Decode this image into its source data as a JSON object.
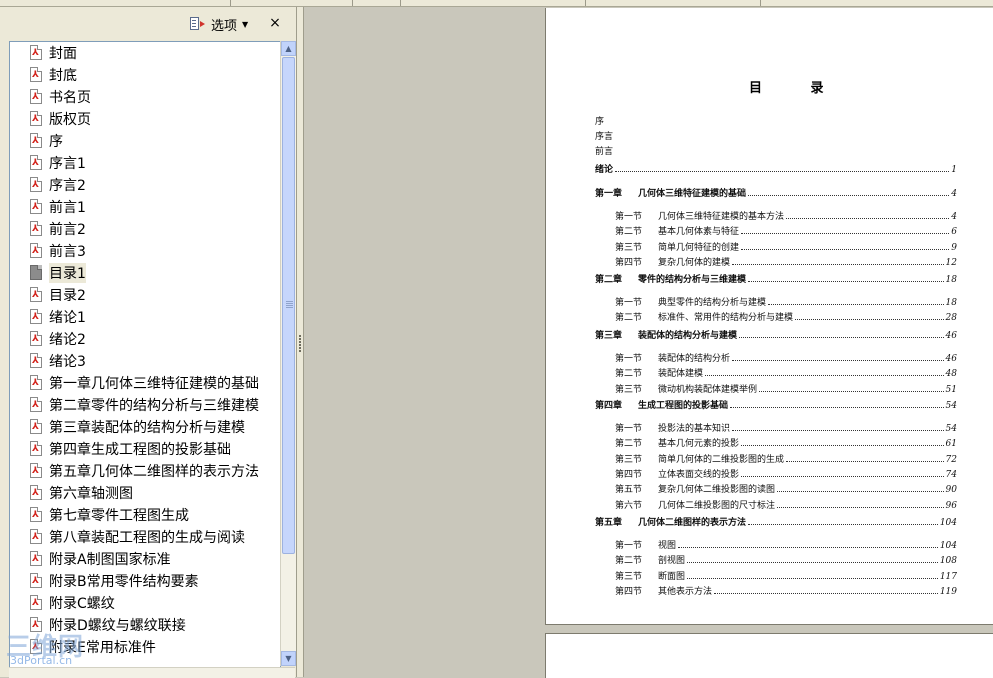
{
  "panel": {
    "options_label": "选项",
    "close_glyph": "×",
    "bookmarks": [
      {
        "label": "封面"
      },
      {
        "label": "封底"
      },
      {
        "label": "书名页"
      },
      {
        "label": "版权页"
      },
      {
        "label": "序"
      },
      {
        "label": "序言1"
      },
      {
        "label": "序言2"
      },
      {
        "label": "前言1"
      },
      {
        "label": "前言2"
      },
      {
        "label": "前言3"
      },
      {
        "label": "目录1",
        "current": true
      },
      {
        "label": "目录2"
      },
      {
        "label": "绪论1"
      },
      {
        "label": "绪论2"
      },
      {
        "label": "绪论3"
      },
      {
        "label": "第一章几何体三维特征建模的基础"
      },
      {
        "label": "第二章零件的结构分析与三维建模"
      },
      {
        "label": "第三章装配体的结构分析与建模"
      },
      {
        "label": "第四章生成工程图的投影基础"
      },
      {
        "label": "第五章几何体二维图样的表示方法"
      },
      {
        "label": "第六章轴测图"
      },
      {
        "label": "第七章零件工程图生成"
      },
      {
        "label": "第八章装配工程图的生成与阅读"
      },
      {
        "label": "附录A制图国家标准"
      },
      {
        "label": "附录B常用零件结构要素"
      },
      {
        "label": "附录C螺纹"
      },
      {
        "label": "附录D螺纹与螺纹联接"
      },
      {
        "label": "附录E常用标准件"
      }
    ]
  },
  "document": {
    "toc_title": "目 录",
    "front_items": [
      "序",
      "序言",
      "前言"
    ],
    "intro": {
      "title": "绪论",
      "page": "1"
    },
    "chapters": [
      {
        "no": "第一章",
        "title": "几何体三维特征建模的基础",
        "page": "4",
        "sections": [
          {
            "no": "第一节",
            "title": "几何体三维特征建模的基本方法",
            "page": "4"
          },
          {
            "no": "第二节",
            "title": "基本几何体素与特征",
            "page": "6"
          },
          {
            "no": "第三节",
            "title": "简单几何特征的创建",
            "page": "9"
          },
          {
            "no": "第四节",
            "title": "复杂几何体的建模",
            "page": "12"
          }
        ]
      },
      {
        "no": "第二章",
        "title": "零件的结构分析与三维建模",
        "page": "18",
        "sections": [
          {
            "no": "第一节",
            "title": "典型零件的结构分析与建模",
            "page": "18"
          },
          {
            "no": "第二节",
            "title": "标准件、常用件的结构分析与建模",
            "page": "28"
          }
        ]
      },
      {
        "no": "第三章",
        "title": "装配体的结构分析与建模",
        "page": "46",
        "sections": [
          {
            "no": "第一节",
            "title": "装配体的结构分析",
            "page": "46"
          },
          {
            "no": "第二节",
            "title": "装配体建模",
            "page": "48"
          },
          {
            "no": "第三节",
            "title": "微动机构装配体建模举例",
            "page": "51"
          }
        ]
      },
      {
        "no": "第四章",
        "title": "生成工程图的投影基础",
        "page": "54",
        "sections": [
          {
            "no": "第一节",
            "title": "投影法的基本知识",
            "page": "54"
          },
          {
            "no": "第二节",
            "title": "基本几何元素的投影",
            "page": "61"
          },
          {
            "no": "第三节",
            "title": "简单几何体的二维投影图的生成",
            "page": "72"
          },
          {
            "no": "第四节",
            "title": "立体表面交线的投影",
            "page": "74"
          },
          {
            "no": "第五节",
            "title": "复杂几何体二维投影图的读图",
            "page": "90"
          },
          {
            "no": "第六节",
            "title": "几何体二维投影图的尺寸标注",
            "page": "96"
          }
        ]
      },
      {
        "no": "第五章",
        "title": "几何体二维图样的表示方法",
        "page": "104",
        "sections": [
          {
            "no": "第一节",
            "title": "视图",
            "page": "104"
          },
          {
            "no": "第二节",
            "title": "剖视图",
            "page": "108"
          },
          {
            "no": "第三节",
            "title": "断面图",
            "page": "117"
          },
          {
            "no": "第四节",
            "title": "其他表示方法",
            "page": "119"
          }
        ]
      }
    ]
  },
  "watermark": {
    "big": "三维网",
    "small": "3dPortal.cn"
  }
}
